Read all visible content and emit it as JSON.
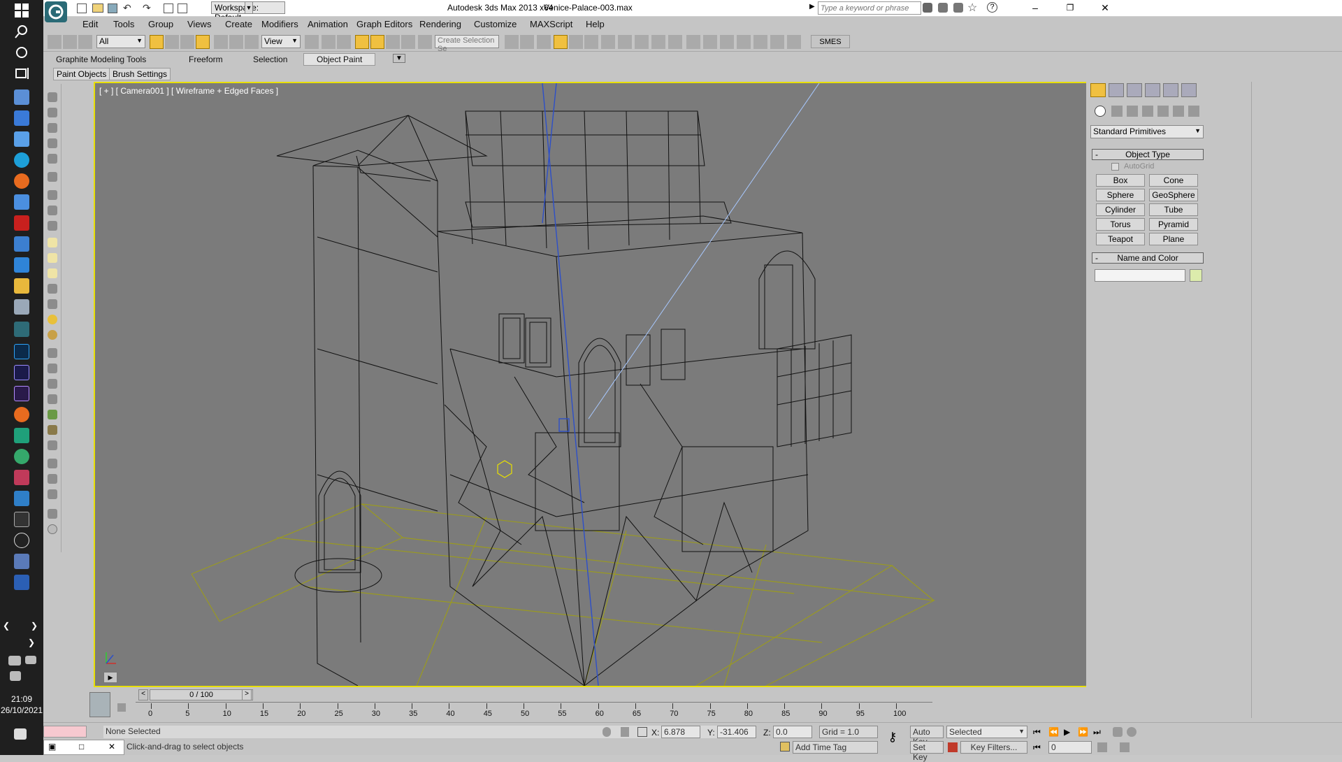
{
  "titlebar": {
    "workspace_label": "Workspace: Default",
    "app_title": "Autodesk 3ds Max  2013 x64",
    "file_name": "Venice-Palace-003.max",
    "search_placeholder": "Type a keyword or phrase"
  },
  "menu": [
    "Edit",
    "Tools",
    "Group",
    "Views",
    "Create",
    "Modifiers",
    "Animation",
    "Graph Editors",
    "Rendering",
    "Customize",
    "MAXScript",
    "Help"
  ],
  "toolbar": {
    "selection_filter": "All",
    "reference_coord": "View",
    "named_selection_placeholder": "Create Selection Se",
    "smes_label": "SMES"
  },
  "ribbon": {
    "tabs": [
      "Graphite Modeling Tools",
      "Freeform",
      "Selection",
      "Object Paint"
    ],
    "active_tab": "Object Paint",
    "subtabs": [
      "Paint Objects",
      "Brush Settings"
    ]
  },
  "viewport": {
    "label": "[ + ] [ Camera001 ] [ Wireframe + Edged Faces ]"
  },
  "command_panel": {
    "category": "Standard Primitives",
    "object_type_title": "Object Type",
    "autogrid_label": "AutoGrid",
    "buttons": [
      "Box",
      "Cone",
      "Sphere",
      "GeoSphere",
      "Cylinder",
      "Tube",
      "Torus",
      "Pyramid",
      "Teapot",
      "Plane"
    ],
    "name_color_title": "Name and Color",
    "name_value": ""
  },
  "timeline": {
    "frame_display": "0 / 100",
    "ticks": [
      "0",
      "5",
      "10",
      "15",
      "20",
      "25",
      "30",
      "35",
      "40",
      "45",
      "50",
      "55",
      "60",
      "65",
      "70",
      "75",
      "80",
      "85",
      "90",
      "95",
      "100"
    ]
  },
  "status": {
    "selection_status": "None Selected",
    "prompt": "Click-and-drag to select objects",
    "x_label": "X:",
    "x_value": "6.878",
    "y_label": "Y:",
    "y_value": "-31.406",
    "z_label": "Z:",
    "z_value": "0.0",
    "grid": "Grid = 1.0",
    "add_time_tag": "Add Time Tag",
    "auto_key": "Auto Key",
    "set_key": "Set Key",
    "key_mode": "Selected",
    "key_filters": "Key Filters...",
    "current_frame": "0"
  },
  "system": {
    "time": "21:09",
    "date": "26/10/2021"
  },
  "colors": {
    "viewport_bg": "#7b7b7b",
    "active_border": "#e8e000",
    "wire": "#111111"
  }
}
